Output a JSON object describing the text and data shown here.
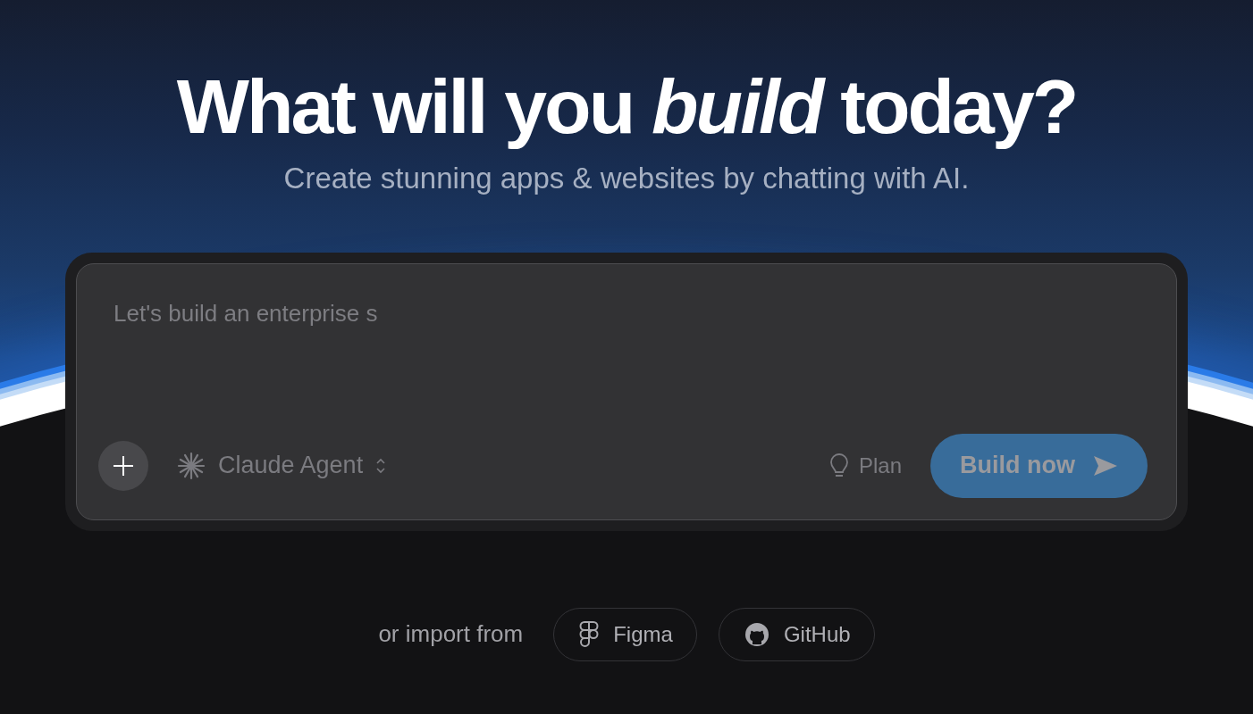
{
  "hero": {
    "title": "What will you *build* today?",
    "subtitle": "Create stunning apps & websites by chatting with AI."
  },
  "prompt": {
    "placeholder": "Let's build an enterprise s",
    "model": "Claude Agent",
    "plan": "Plan",
    "submit": {
      "label": "Build now",
      "disabled": true
    }
  },
  "import": {
    "label": "or import from",
    "sources": [
      {
        "kind": "figma",
        "label": "Figma"
      },
      {
        "kind": "github",
        "label": "GitHub"
      }
    ]
  }
}
